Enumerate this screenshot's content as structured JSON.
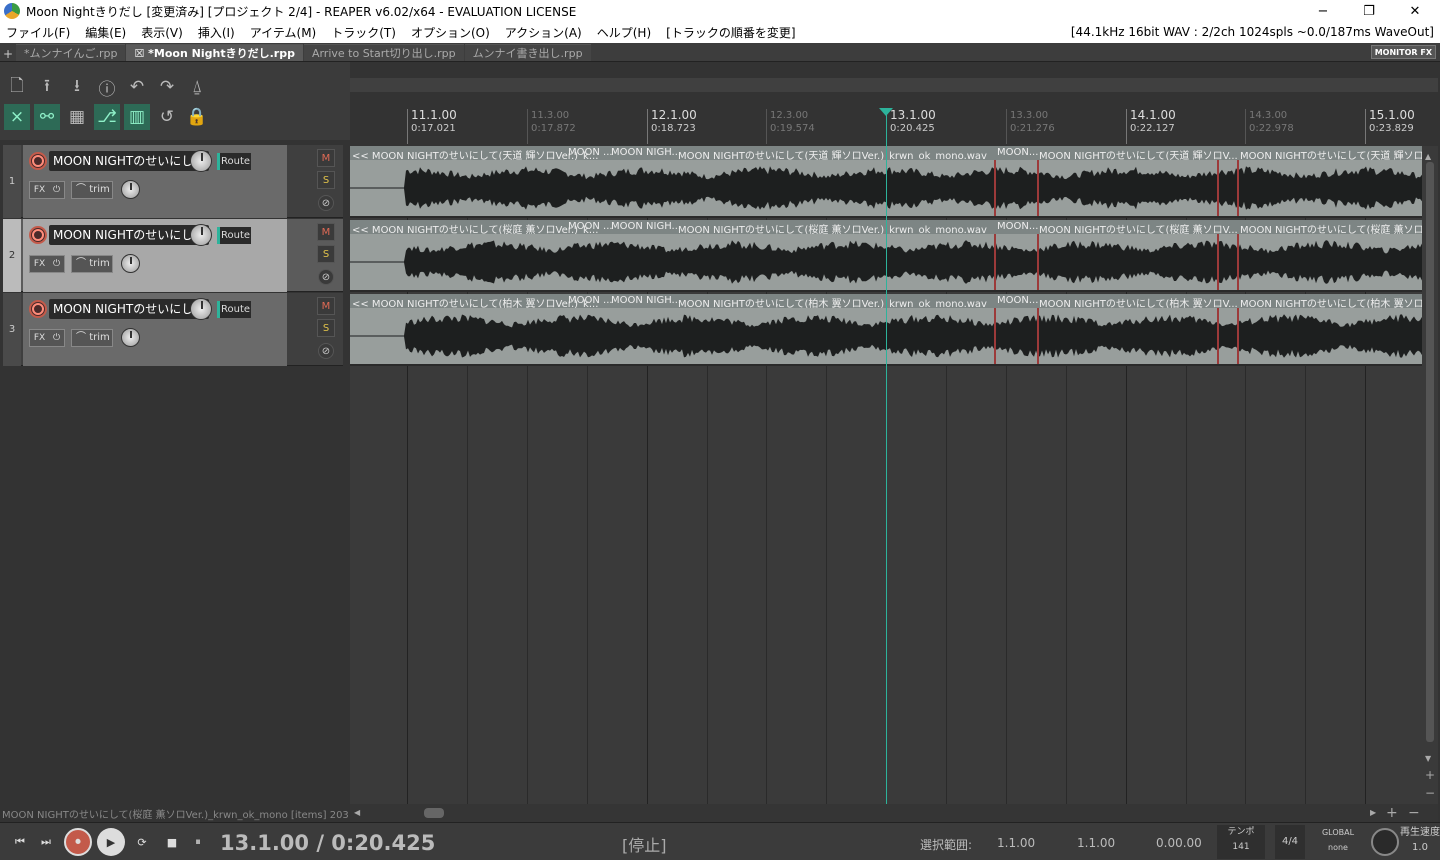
{
  "window": {
    "title": "Moon Nightきりだし [変更済み] [プロジェクト 2/4] - REAPER v6.02/x64 - EVALUATION LICENSE",
    "minimize": "−",
    "maximize": "❐",
    "close": "✕"
  },
  "menu": {
    "items": [
      "ファイル(F)",
      "編集(E)",
      "表示(V)",
      "挿入(I)",
      "アイテム(M)",
      "トラック(T)",
      "オプション(O)",
      "アクション(A)",
      "ヘルプ(H)",
      "[トラックの順番を変更]"
    ],
    "info": "[44.1kHz 16bit WAV : 2/2ch 1024spls ~0.0/187ms WaveOut]"
  },
  "tabs": {
    "add": "+",
    "items": [
      "*ムンナイんご.rpp",
      "☒ *Moon Nightきりだし.rpp",
      "Arrive to Start切り出し.rpp",
      "ムンナイ書き出し.rpp"
    ],
    "active": 1,
    "monitor_fx": "MONITOR FX"
  },
  "toolbar": {
    "icons": [
      "new-project-icon",
      "save-project-icon",
      "open-project-icon",
      "info-icon",
      "undo-icon",
      "redo-icon",
      "metronome-icon",
      "ripple-edit-icon",
      "link-icon",
      "grid-icon",
      "snap-icon",
      "track-grid-icon",
      "loop-icon",
      "lock-icon"
    ],
    "glyphs": [
      "🗋",
      "⭱",
      "⭳",
      "ⓘ",
      "↶",
      "↷",
      "⍙",
      "⨯",
      "⚯",
      "▦",
      "⎇",
      "▥",
      "↺",
      "🔒"
    ]
  },
  "ruler": {
    "marks": [
      {
        "bar": "11.1.00",
        "time": "0:17.021",
        "major": true
      },
      {
        "bar": "11.3.00",
        "time": "0:17.872",
        "major": false
      },
      {
        "bar": "12.1.00",
        "time": "0:18.723",
        "major": true
      },
      {
        "bar": "12.3.00",
        "time": "0:19.574",
        "major": false
      },
      {
        "bar": "13.1.00",
        "time": "0:20.425",
        "major": true
      },
      {
        "bar": "13.3.00",
        "time": "0:21.276",
        "major": false
      },
      {
        "bar": "14.1.00",
        "time": "0:22.127",
        "major": true
      },
      {
        "bar": "14.3.00",
        "time": "0:22.978",
        "major": false
      },
      {
        "bar": "15.1.00",
        "time": "0:23.829",
        "major": true
      }
    ]
  },
  "tracks": [
    {
      "number": "1",
      "name": "MOON NIGHTのせいにして(天道 輝ソロVer.)",
      "route": "Route",
      "fx": "FX",
      "trim": "trim",
      "mute": "M",
      "solo": "S",
      "phase": "⊘",
      "selected": false,
      "items": [
        "<< MOON NIGHTのせいにして(天道 輝ソロVer.)_k...",
        "MOON ...",
        "MOON NIGH...",
        "MOON NIGHTのせいにして(天道 輝ソロVer.)_krwn_ok_mono.wav",
        "MOON...",
        "MOON NIGHTのせいにして(天道 輝ソロV...",
        "MOON NIGHTのせいにして(天道 輝ソロVer.)"
      ]
    },
    {
      "number": "2",
      "name": "MOON NIGHTのせいにして(桜庭 薫ソロVer.)",
      "route": "Route",
      "fx": "FX",
      "trim": "trim",
      "mute": "M",
      "solo": "S",
      "phase": "⊘",
      "selected": true,
      "items": [
        "<< MOON NIGHTのせいにして(桜庭 薫ソロVer.)_k...",
        "MOON ...",
        "MOON NIGH...",
        "MOON NIGHTのせいにして(桜庭 薫ソロVer.)_krwn_ok_mono.wav",
        "MOON...",
        "MOON NIGHTのせいにして(桜庭 薫ソロV...",
        "MOON NIGHTのせいにして(桜庭 薫ソロVer.)"
      ]
    },
    {
      "number": "3",
      "name": "MOON NIGHTのせいにして(柏木 翼ソロVer.)",
      "route": "Route",
      "fx": "FX",
      "trim": "trim",
      "mute": "M",
      "solo": "S",
      "phase": "⊘",
      "selected": false,
      "items": [
        "<< MOON NIGHTのせいにして(柏木 翼ソロVer.)_k...",
        "MOON ...",
        "MOON NIGH...",
        "MOON NIGHTのせいにして(柏木 翼ソロVer.)_krwn_ok_mono.wav",
        "MOON...",
        "MOON NIGHTのせいにして(柏木 翼ソロV...",
        "MOON NIGHTのせいにして(柏木 翼ソロVer.)"
      ]
    }
  ],
  "status": {
    "left": "MOON NIGHTのせいにして(桜庭 薫ソロVer.)_krwn_ok_mono [items] 203"
  },
  "transport": {
    "glyphs": {
      "prev": "⏮",
      "next": "⏭",
      "record": "⏺",
      "play": "▶",
      "repeat": "⟳",
      "stop": "■",
      "pause": "⏸"
    },
    "position": "13.1.00 / 0:20.425",
    "state": "[停止]",
    "selection_label": "選択範囲:",
    "selection_start": "1.1.00",
    "selection_end": "1.1.00",
    "selection_length": "0.00.00",
    "tempo_label": "テンポ",
    "tempo": "141",
    "timesig": "4/4",
    "global_label": "GLOBAL",
    "global_value": "none",
    "rate_label": "再生速度",
    "rate": "1.0"
  },
  "colors": {
    "accent": "#2db39b",
    "item_bg": "#989e9c",
    "split": "#9c3a3a",
    "record": "#c35a4a"
  }
}
